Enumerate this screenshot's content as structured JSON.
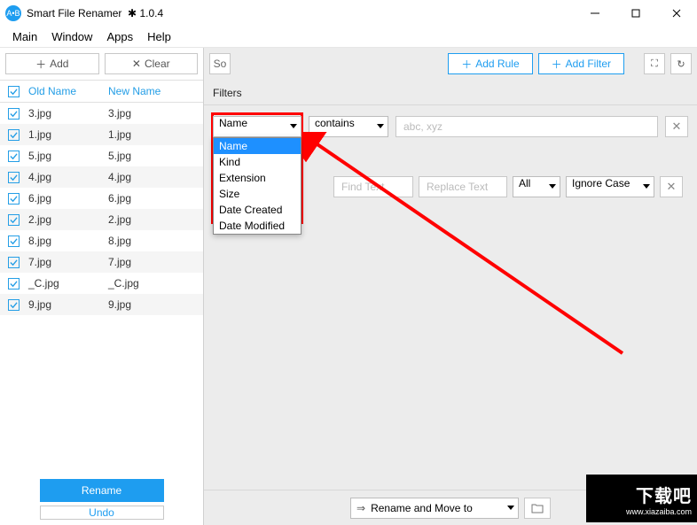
{
  "titlebar": {
    "app_name": "Smart File Renamer",
    "star": "✱",
    "version": "1.0.4"
  },
  "menu": [
    "Main",
    "Window",
    "Apps",
    "Help"
  ],
  "left_toolbar": {
    "add": "Add",
    "clear": "Clear"
  },
  "grid": {
    "headers": {
      "old": "Old Name",
      "new": "New Name"
    },
    "rows": [
      {
        "old": "3.jpg",
        "new": "3.jpg"
      },
      {
        "old": "1.jpg",
        "new": "1.jpg"
      },
      {
        "old": "5.jpg",
        "new": "5.jpg"
      },
      {
        "old": "4.jpg",
        "new": "4.jpg"
      },
      {
        "old": "6.jpg",
        "new": "6.jpg"
      },
      {
        "old": "2.jpg",
        "new": "2.jpg"
      },
      {
        "old": "8.jpg",
        "new": "8.jpg"
      },
      {
        "old": "7.jpg",
        "new": "7.jpg"
      },
      {
        "old": "_C.jpg",
        "new": "_C.jpg"
      },
      {
        "old": "9.jpg",
        "new": "9.jpg"
      }
    ]
  },
  "left_bottom": {
    "rename": "Rename",
    "undo": "Undo"
  },
  "right_toolbar": {
    "so": "So",
    "add_rule": "Add Rule",
    "add_filter": "Add Filter"
  },
  "filters": {
    "heading": "Filters",
    "field_sel": "Name",
    "cond_sel": "contains",
    "value_ph": "abc, xyz",
    "dropdown": [
      "Name",
      "Kind",
      "Extension",
      "Size",
      "Date Created",
      "Date Modified"
    ]
  },
  "rule": {
    "find_ph": "Find Text",
    "replace_ph": "Replace Text",
    "all": "All",
    "ignore_case": "Ignore Case"
  },
  "bottom": {
    "move": "Rename and Move to"
  },
  "watermark": {
    "big": "下载吧",
    "small": "www.xiazaiba.com"
  }
}
